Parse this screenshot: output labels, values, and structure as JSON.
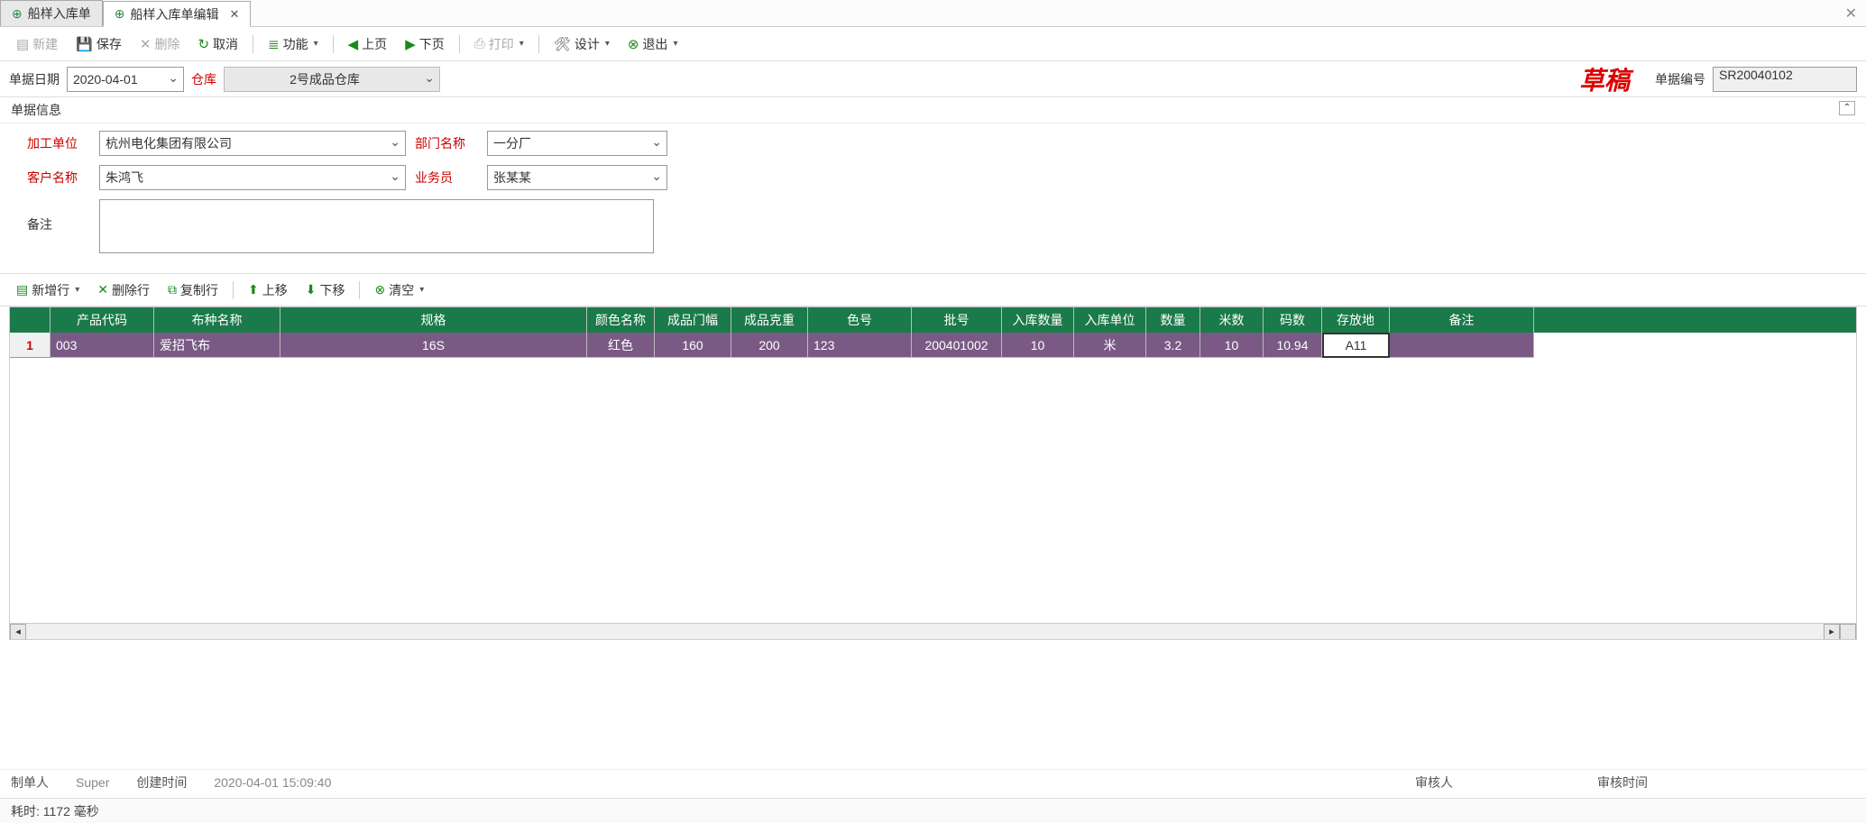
{
  "tabs": [
    {
      "label": "船样入库单",
      "active": false
    },
    {
      "label": "船样入库单编辑",
      "active": true
    }
  ],
  "toolbar": {
    "new": "新建",
    "save": "保存",
    "delete": "删除",
    "cancel": "取消",
    "func": "功能",
    "prev": "上页",
    "next": "下页",
    "print": "打印",
    "design": "设计",
    "exit": "退出"
  },
  "query": {
    "date_label": "单据日期",
    "date_value": "2020-04-01",
    "warehouse_label": "仓库",
    "warehouse_value": "2号成品仓库",
    "status": "草稿",
    "docno_label": "单据编号",
    "docno_value": "SR20040102"
  },
  "section_title": "单据信息",
  "form": {
    "unit_label": "加工单位",
    "unit_value": "杭州电化集团有限公司",
    "dept_label": "部门名称",
    "dept_value": "一分厂",
    "cust_label": "客户名称",
    "cust_value": "朱鸿飞",
    "sales_label": "业务员",
    "sales_value": "张某某",
    "remark_label": "备注",
    "remark_value": ""
  },
  "grid_toolbar": {
    "addrow": "新增行",
    "delrow": "删除行",
    "copyrow": "复制行",
    "moveup": "上移",
    "movedown": "下移",
    "clear": "清空"
  },
  "grid": {
    "columns": [
      "产品代码",
      "布种名称",
      "规格",
      "颜色名称",
      "成品门幅",
      "成品克重",
      "色号",
      "批号",
      "入库数量",
      "入库单位",
      "数量",
      "米数",
      "码数",
      "存放地",
      "备注"
    ],
    "rows": [
      {
        "n": "1",
        "cells": [
          "003",
          "爱招飞布",
          "16S",
          "红色",
          "160",
          "200",
          "123",
          "200401002",
          "10",
          "米",
          "3.2",
          "10",
          "10.94",
          "A11",
          ""
        ],
        "editing_col": 13
      }
    ]
  },
  "footer": {
    "maker_label": "制单人",
    "maker_value": "Super",
    "create_label": "创建时间",
    "create_value": "2020-04-01 15:09:40",
    "auditor_label": "审核人",
    "auditor_value": "",
    "audit_time_label": "审核时间",
    "audit_time_value": ""
  },
  "status_bar": "耗时: 1172 毫秒"
}
